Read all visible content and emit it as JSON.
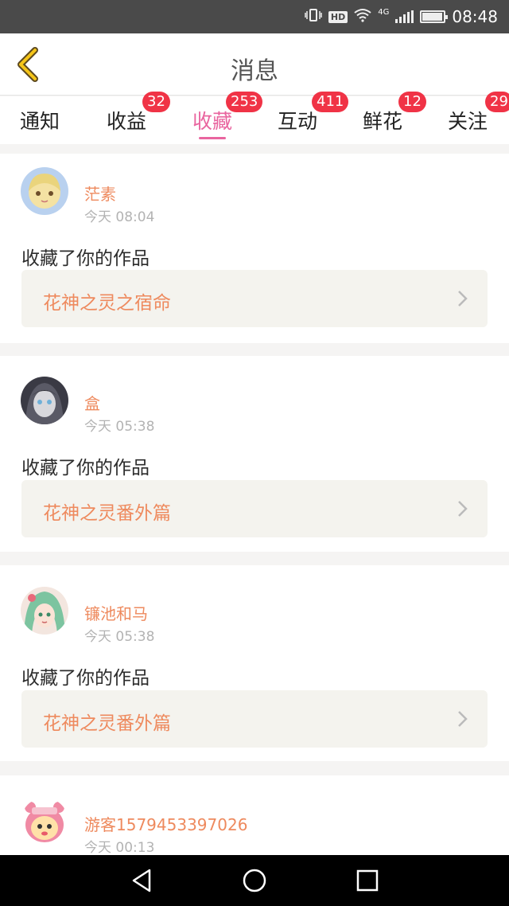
{
  "status_bar": {
    "time": "08:48",
    "network": "4G",
    "hd": "HD",
    "battery_level": 0.95
  },
  "header": {
    "title": "消息",
    "back_icon": "chevron-left-icon"
  },
  "tabs": [
    {
      "label": "通知",
      "badge": ""
    },
    {
      "label": "收益",
      "badge": "32"
    },
    {
      "label": "收藏",
      "badge": "253",
      "active": true
    },
    {
      "label": "互动",
      "badge": "411"
    },
    {
      "label": "鲜花",
      "badge": "12"
    },
    {
      "label": "关注",
      "badge": "29"
    }
  ],
  "messages": [
    {
      "username": "茫素",
      "time": "今天 08:04",
      "action": "收藏了你的作品",
      "work_title": "花神之灵之宿命",
      "avatar": "anime-girl-blonde-avatar"
    },
    {
      "username": "盒",
      "time": "今天 05:38",
      "action": "收藏了你的作品",
      "work_title": "花神之灵番外篇",
      "avatar": "anime-girl-dark-avatar"
    },
    {
      "username": "镰池和马",
      "time": "今天 05:38",
      "action": "收藏了你的作品",
      "work_title": "花神之灵番外篇",
      "avatar": "anime-girl-green-hair-avatar"
    },
    {
      "username": "游客1579453397026",
      "time": "今天 00:13",
      "action": "",
      "work_title": "",
      "avatar": "pink-mascot-avatar"
    }
  ],
  "colors": {
    "accent": "#e9659f",
    "badge": "#f03346",
    "orange_text": "#ee8a5e",
    "work_bg": "#f4f3ee"
  }
}
